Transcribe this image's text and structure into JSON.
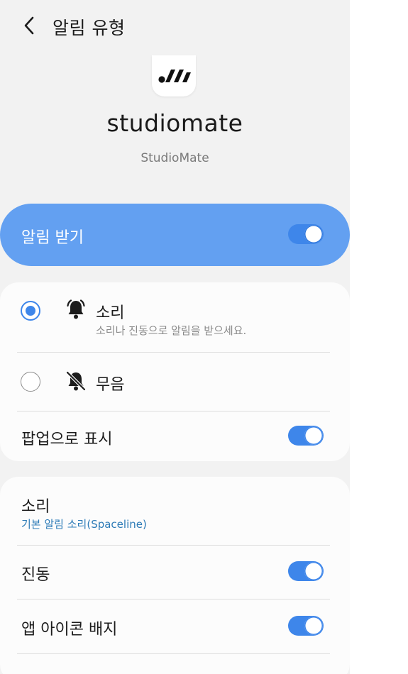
{
  "header": {
    "title": "알림 유형"
  },
  "app": {
    "name": "studiomate",
    "subtitle": "StudioMate"
  },
  "master": {
    "label": "알림 받기",
    "enabled": true
  },
  "alert_mode": {
    "selected": "sound",
    "options": [
      {
        "key": "sound",
        "title": "소리",
        "description": "소리나 진동으로 알림을 받으세요.",
        "icon": "bell-ringing-icon"
      },
      {
        "key": "silent",
        "title": "무음",
        "icon": "bell-off-icon"
      }
    ]
  },
  "popup": {
    "label": "팝업으로 표시",
    "enabled": true
  },
  "sound_setting": {
    "label": "소리",
    "value": "기본 알림 소리(Spaceline)"
  },
  "vibration": {
    "label": "진동",
    "enabled": true
  },
  "badge": {
    "label": "앱 아이콘 배지",
    "enabled": true
  },
  "colors": {
    "accent": "#3e86ea",
    "master_bg": "#63a0f1",
    "link": "#2d7bb7"
  }
}
